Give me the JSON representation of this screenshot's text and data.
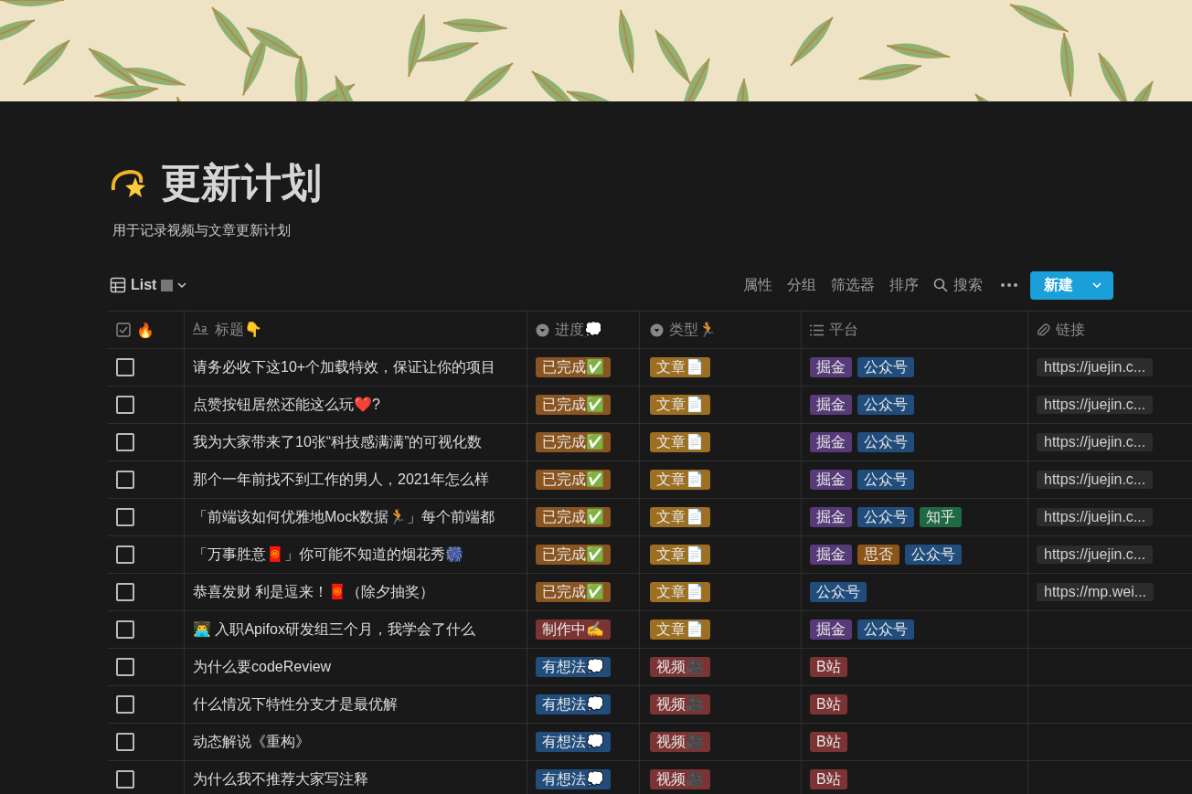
{
  "page": {
    "title": "更新计划",
    "description": "用于记录视频与文章更新计划"
  },
  "view": {
    "name": "List"
  },
  "toolbar": {
    "actions": [
      "属性",
      "分组",
      "筛选器",
      "排序"
    ],
    "search": "搜索",
    "new_button": "新建"
  },
  "table": {
    "columns": [
      {
        "kind": "checkbox",
        "label": "🔥"
      },
      {
        "kind": "title",
        "label": "标题👇"
      },
      {
        "kind": "select",
        "label": "进度💭"
      },
      {
        "kind": "select",
        "label": "类型🏃"
      },
      {
        "kind": "multi",
        "label": "平台"
      },
      {
        "kind": "url",
        "label": "链接"
      }
    ],
    "rows": [
      {
        "checked": false,
        "title": "请务必收下这10+个加载特效，保证让你的项目",
        "progress": {
          "label": "已完成✅",
          "color": "#8a5520"
        },
        "type": {
          "label": "文章📄",
          "color": "#9c6f22"
        },
        "platforms": [
          {
            "label": "掘金",
            "color": "#563b78"
          },
          {
            "label": "公众号",
            "color": "#214d7c"
          }
        ],
        "link": "https://juejin.c..."
      },
      {
        "checked": false,
        "title": "点赞按钮居然还能这么玩❤️?",
        "progress": {
          "label": "已完成✅",
          "color": "#8a5520"
        },
        "type": {
          "label": "文章📄",
          "color": "#9c6f22"
        },
        "platforms": [
          {
            "label": "掘金",
            "color": "#563b78"
          },
          {
            "label": "公众号",
            "color": "#214d7c"
          }
        ],
        "link": "https://juejin.c..."
      },
      {
        "checked": false,
        "title": "我为大家带来了10张“科技感满满”的可视化数",
        "progress": {
          "label": "已完成✅",
          "color": "#8a5520"
        },
        "type": {
          "label": "文章📄",
          "color": "#9c6f22"
        },
        "platforms": [
          {
            "label": "掘金",
            "color": "#563b78"
          },
          {
            "label": "公众号",
            "color": "#214d7c"
          }
        ],
        "link": "https://juejin.c..."
      },
      {
        "checked": false,
        "title": "那个一年前找不到工作的男人，2021年怎么样",
        "progress": {
          "label": "已完成✅",
          "color": "#8a5520"
        },
        "type": {
          "label": "文章📄",
          "color": "#9c6f22"
        },
        "platforms": [
          {
            "label": "掘金",
            "color": "#563b78"
          },
          {
            "label": "公众号",
            "color": "#214d7c"
          }
        ],
        "link": "https://juejin.c..."
      },
      {
        "checked": false,
        "title": "「前端该如何优雅地Mock数据🏃」每个前端都",
        "progress": {
          "label": "已完成✅",
          "color": "#8a5520"
        },
        "type": {
          "label": "文章📄",
          "color": "#9c6f22"
        },
        "platforms": [
          {
            "label": "掘金",
            "color": "#563b78"
          },
          {
            "label": "公众号",
            "color": "#214d7c"
          },
          {
            "label": "知乎",
            "color": "#1e6a45"
          }
        ],
        "link": "https://juejin.c..."
      },
      {
        "checked": false,
        "title": "「万事胜意🧧」你可能不知道的烟花秀🎆",
        "progress": {
          "label": "已完成✅",
          "color": "#8a5520"
        },
        "type": {
          "label": "文章📄",
          "color": "#9c6f22"
        },
        "platforms": [
          {
            "label": "掘金",
            "color": "#563b78"
          },
          {
            "label": "思否",
            "color": "#8c5419"
          },
          {
            "label": "公众号",
            "color": "#214d7c"
          }
        ],
        "link": "https://juejin.c..."
      },
      {
        "checked": false,
        "title": "恭喜发财 利是逗来！🧧（除夕抽奖）",
        "progress": {
          "label": "已完成✅",
          "color": "#8a5520"
        },
        "type": {
          "label": "文章📄",
          "color": "#9c6f22"
        },
        "platforms": [
          {
            "label": "公众号",
            "color": "#214d7c"
          }
        ],
        "link": "https://mp.wei..."
      },
      {
        "checked": false,
        "title": "👨‍💻 入职Apifox研发组三个月，我学会了什么",
        "progress": {
          "label": "制作中✍️",
          "color": "#7c3333"
        },
        "type": {
          "label": "文章📄",
          "color": "#9c6f22"
        },
        "platforms": [
          {
            "label": "掘金",
            "color": "#563b78"
          },
          {
            "label": "公众号",
            "color": "#214d7c"
          }
        ]
      },
      {
        "checked": false,
        "title": "为什么要codeReview",
        "progress": {
          "label": "有想法💭",
          "color": "#214d7c"
        },
        "type": {
          "label": "视频🎥",
          "color": "#7c3333"
        },
        "platforms": [
          {
            "label": "B站",
            "color": "#7c3333"
          }
        ]
      },
      {
        "checked": false,
        "title": "什么情况下特性分支才是最优解",
        "progress": {
          "label": "有想法💭",
          "color": "#214d7c"
        },
        "type": {
          "label": "视频🎥",
          "color": "#7c3333"
        },
        "platforms": [
          {
            "label": "B站",
            "color": "#7c3333"
          }
        ]
      },
      {
        "checked": false,
        "title": "动态解说《重构》",
        "progress": {
          "label": "有想法💭",
          "color": "#214d7c"
        },
        "type": {
          "label": "视频🎥",
          "color": "#7c3333"
        },
        "platforms": [
          {
            "label": "B站",
            "color": "#7c3333"
          }
        ]
      },
      {
        "checked": false,
        "title": "为什么我不推荐大家写注释",
        "progress": {
          "label": "有想法💭",
          "color": "#214d7c"
        },
        "type": {
          "label": "视频🎥",
          "color": "#7c3333"
        },
        "platforms": [
          {
            "label": "B站",
            "color": "#7c3333"
          }
        ]
      }
    ]
  }
}
